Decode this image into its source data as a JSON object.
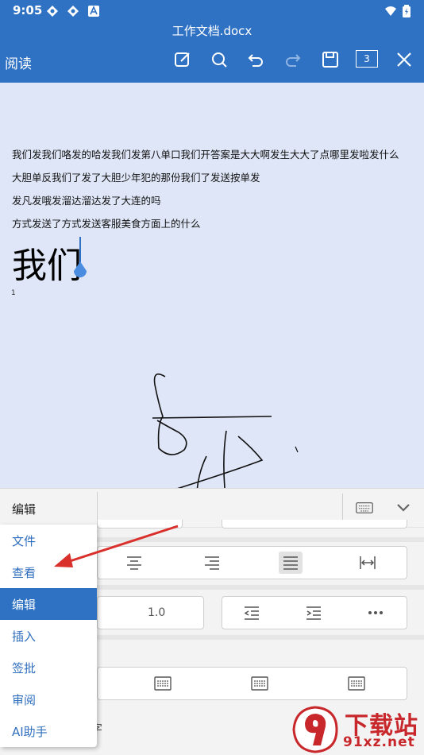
{
  "status_bar": {
    "time": "9:05"
  },
  "titlebar": {
    "doc_title": "工作文档.docx",
    "read_label": "阅读",
    "page_count": "3"
  },
  "document": {
    "lines": [
      "我们发我们咯发的哈发我们发第八单口我们开答案是大大啊发生大大了点哪里发啦发什么",
      "大胆单反我们了发了大胆少年犯的那份我们了发送按单发",
      "发凡发哦发溜达溜达发了大连的吗",
      "方式发送了方式发送客服美食方面上的什么"
    ],
    "big_text": "我们",
    "small_mark": "1"
  },
  "panel": {
    "tab_label": "编辑",
    "line_spacing_value": "1.0"
  },
  "side_menu": {
    "items": [
      "文件",
      "查看",
      "编辑",
      "插入",
      "签批",
      "审阅",
      "AI助手"
    ],
    "active_index": 2
  },
  "partial_text": "字",
  "watermark": {
    "line1": "下载站",
    "line2": "91xz.net",
    "logo_glyph": "9"
  },
  "colors": {
    "accent": "#2f72c3",
    "doc_bg": "#dfe6f7",
    "watermark": "#c8282b"
  }
}
